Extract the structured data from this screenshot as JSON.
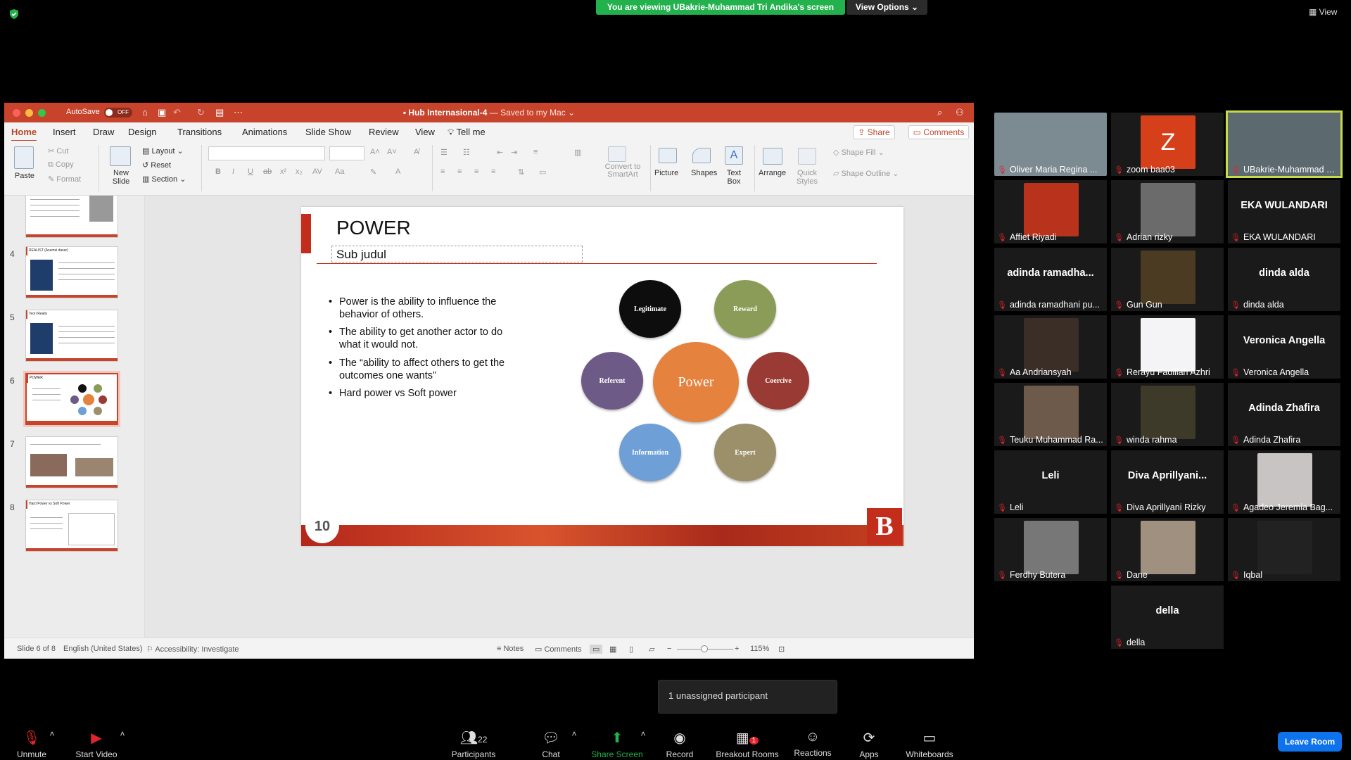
{
  "zoom": {
    "banner": "You are viewing UBakrie-Muhammad Tri Andika's screen",
    "view_options": "View Options ⌄",
    "view_button": "View",
    "unassigned_popup": "1 unassigned participant",
    "toolbar": {
      "unmute": "Unmute",
      "start_video": "Start Video",
      "participants": "Participants",
      "participants_count": "22",
      "chat": "Chat",
      "share_screen": "Share Screen",
      "record": "Record",
      "breakout_rooms": "Breakout Rooms",
      "breakout_badge": "1",
      "reactions": "Reactions",
      "apps": "Apps",
      "whiteboards": "Whiteboards",
      "leave_room": "Leave Room"
    },
    "gallery": [
      {
        "name": "Oliver Maria Regina ...",
        "big": "",
        "type": "photo",
        "color": "#7c8a92"
      },
      {
        "name": "zoom baa03",
        "big": "",
        "type": "avatar",
        "color": "#d5401a",
        "letter": "Z"
      },
      {
        "name": "UBakrie-Muhammad Tri...",
        "big": "",
        "type": "photo",
        "color": "#5c6a70",
        "active": true
      },
      {
        "name": "Affiet Riyadi",
        "big": "",
        "type": "photo",
        "color": "#b8321c"
      },
      {
        "name": "Adrian rizky",
        "big": "",
        "type": "photo",
        "color": "#6b6b6b"
      },
      {
        "name": "EKA WULANDARI",
        "big": "EKA WULANDARI",
        "type": "text"
      },
      {
        "name": "adinda ramadhani pu...",
        "big": "adinda  ramadha...",
        "type": "text"
      },
      {
        "name": "Gun Gun",
        "big": "",
        "type": "photo",
        "color": "#4a3b22"
      },
      {
        "name": "dinda alda",
        "big": "dinda alda",
        "type": "text"
      },
      {
        "name": "Aa Andriansyah",
        "big": "",
        "type": "photo",
        "color": "#3a2e26"
      },
      {
        "name": "Rerayu Fadillah Azhri",
        "big": "",
        "type": "photo",
        "color": "#f4f4f6"
      },
      {
        "name": "Veronica Angella",
        "big": "Veronica Angella",
        "type": "text"
      },
      {
        "name": "Teuku Muhammad Ra...",
        "big": "",
        "type": "photo",
        "color": "#6e5a4a"
      },
      {
        "name": "winda rahma",
        "big": "",
        "type": "photo",
        "color": "#3d3a2a"
      },
      {
        "name": "Adinda Zhafira",
        "big": "Adinda Zhafira",
        "type": "text"
      },
      {
        "name": "Leli",
        "big": "Leli",
        "type": "text"
      },
      {
        "name": "Diva Aprillyani Rizky",
        "big": "Diva  Aprillyani...",
        "type": "text"
      },
      {
        "name": "Agadeo Jeremia Bag...",
        "big": "",
        "type": "photo",
        "color": "#c9c4c4"
      },
      {
        "name": "Ferdhy Butera",
        "big": "",
        "type": "photo",
        "color": "#777"
      },
      {
        "name": "Dane",
        "big": "",
        "type": "photo",
        "color": "#a09080"
      },
      {
        "name": "Iqbal",
        "big": "",
        "type": "photo",
        "color": "#222"
      },
      {
        "name": "della",
        "big": "della",
        "type": "text"
      }
    ]
  },
  "ppt": {
    "autosave": "AutoSave",
    "autosave_state": "OFF",
    "doc_title": "Hub Internasional-4",
    "doc_status": " — Saved to my Mac ⌄",
    "menu": [
      "Home",
      "Insert",
      "Draw",
      "Design",
      "Transitions",
      "Animations",
      "Slide Show",
      "Review",
      "View"
    ],
    "tell_me": "Tell me",
    "share": "Share",
    "comments": "Comments",
    "ribbon": {
      "paste": "Paste",
      "cut": "Cut",
      "copy": "Copy",
      "format": "Format",
      "new_slide": "New\nSlide",
      "layout": "Layout",
      "reset": "Reset",
      "section": "Section",
      "convert_smartart": "Convert to\nSmartArt",
      "picture": "Picture",
      "shapes": "Shapes",
      "text_box": "Text\nBox",
      "arrange": "Arrange",
      "quick_styles": "Quick\nStyles",
      "shape_fill": "Shape Fill",
      "shape_outline": "Shape Outline"
    },
    "thumbnails": [
      {
        "num": "",
        "title": ""
      },
      {
        "num": "4",
        "title": "REALIST (Asumsi dasar)"
      },
      {
        "num": "5",
        "title": "Teori Realis"
      },
      {
        "num": "6",
        "title": "POWER"
      },
      {
        "num": "7",
        "title": ""
      },
      {
        "num": "8",
        "title": "Hard Power vs Soft Power"
      }
    ],
    "slide": {
      "title": "POWER",
      "subtitle": "Sub judul",
      "bullets": [
        "Power is the ability to influence the behavior of others.",
        "The ability to get another actor to do what it would not.",
        "The “ability to affect others to get the outcomes one wants”",
        "Hard power vs Soft power"
      ],
      "center": "Power",
      "circles": [
        {
          "label": "Legitimate",
          "color": "#0d0d0d"
        },
        {
          "label": "Reward",
          "color": "#8b9c58"
        },
        {
          "label": "Referent",
          "color": "#6e5a86"
        },
        {
          "label": "Coercive",
          "color": "#9a3a34"
        },
        {
          "label": "Information",
          "color": "#6e9fd6"
        },
        {
          "label": "Expert",
          "color": "#9b906a"
        }
      ],
      "center_color": "#e5823e",
      "logo_left": "10",
      "logo_right": "B"
    },
    "status": {
      "slide": "Slide 6 of 8",
      "language": "English (United States)",
      "accessibility": "Accessibility: Investigate",
      "notes": "Notes",
      "comments": "Comments",
      "zoom": "115%"
    }
  }
}
